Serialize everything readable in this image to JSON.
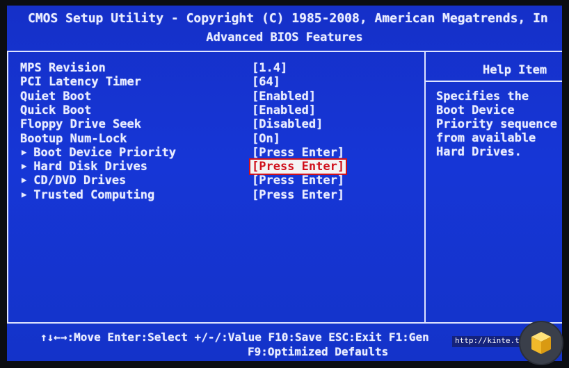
{
  "header": {
    "title": "CMOS Setup Utility - Copyright (C) 1985-2008, American Megatrends, In",
    "subtitle": "Advanced BIOS Features"
  },
  "settings": [
    {
      "label": "MPS Revision",
      "value": "[1.4]",
      "submenu": false,
      "selected": false
    },
    {
      "label": "PCI Latency Timer",
      "value": "[64]",
      "submenu": false,
      "selected": false
    },
    {
      "label": "Quiet Boot",
      "value": "[Enabled]",
      "submenu": false,
      "selected": false
    },
    {
      "label": "Quick Boot",
      "value": "[Enabled]",
      "submenu": false,
      "selected": false
    },
    {
      "label": "Floppy Drive Seek",
      "value": "[Disabled]",
      "submenu": false,
      "selected": false
    },
    {
      "label": "Bootup Num-Lock",
      "value": "[On]",
      "submenu": false,
      "selected": false
    },
    {
      "label": "Boot Device Priority",
      "value": "[Press Enter]",
      "submenu": true,
      "selected": false
    },
    {
      "label": "Hard Disk Drives",
      "value": "[Press Enter]",
      "submenu": true,
      "selected": true
    },
    {
      "label": "CD/DVD Drives",
      "value": "[Press Enter]",
      "submenu": true,
      "selected": false
    },
    {
      "label": "Trusted Computing",
      "value": "[Press Enter]",
      "submenu": true,
      "selected": false
    }
  ],
  "submenu_marker": "▶",
  "help": {
    "title": "Help Item",
    "lines": [
      "Specifies the",
      "Boot Device",
      "Priority sequence",
      "from available",
      "Hard Drives."
    ]
  },
  "footer": {
    "line1": "↑↓←→:Move   Enter:Select   +/-/:Value   F10:Save   ESC:Exit   F1:Gen",
    "line2": "F9:Optimized Defaults"
  },
  "watermark": {
    "text": "http://kinte.ti"
  },
  "colors": {
    "background": "#1636d6",
    "text": "#e9ecff",
    "selected_bg": "#f4f4f4",
    "selected_fg": "#d0101c"
  }
}
